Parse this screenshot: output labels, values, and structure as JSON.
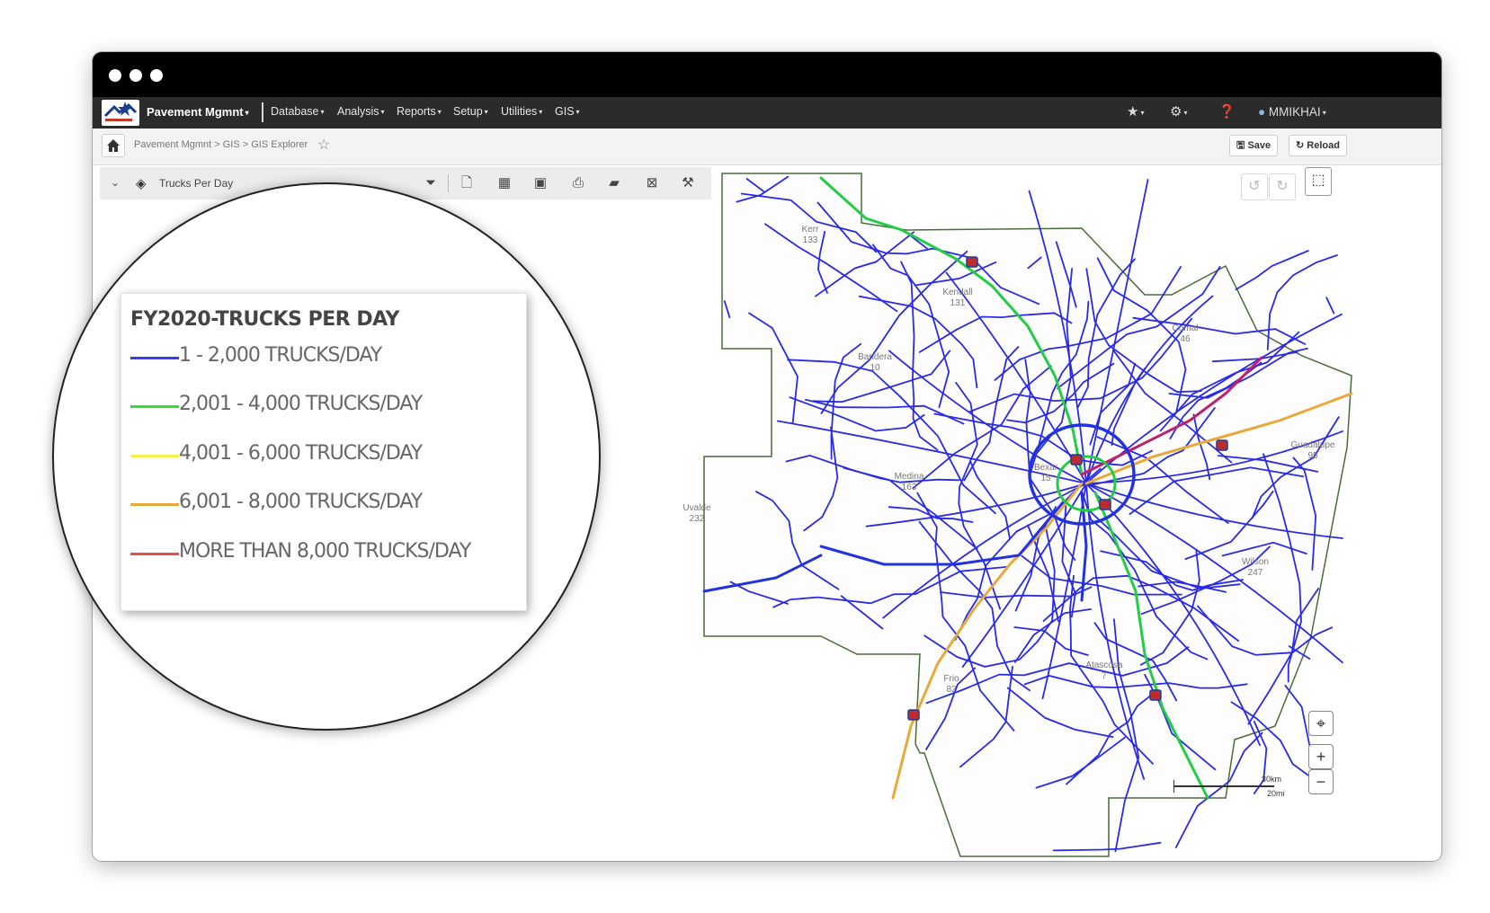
{
  "navbar": {
    "brand": "Pavement Mgmnt",
    "menus": [
      "Database",
      "Analysis",
      "Reports",
      "Setup",
      "Utilities",
      "GIS"
    ],
    "user": "MMIKHAI"
  },
  "breadcrumb": {
    "path": "Pavement Mgmnt > GIS > GIS Explorer"
  },
  "toolbar": {
    "save_label": "Save",
    "reload_label": "Reload"
  },
  "layer": {
    "name": "Trucks Per Day"
  },
  "legend": {
    "title": "FY2020-TRUCKS PER DAY",
    "items": [
      {
        "label": "1 - 2,000 TRUCKS/DAY",
        "color": "#3b3bf0"
      },
      {
        "label": "2,001 - 4,000 TRUCKS/DAY",
        "color": "#33dd33"
      },
      {
        "label": "4,001 - 6,000 TRUCKS/DAY",
        "color": "#f2f24a"
      },
      {
        "label": "6,001 - 8,000 TRUCKS/DAY",
        "color": "#e8a93a"
      },
      {
        "label": "MORE THAN 8,000 TRUCKS/DAY",
        "color": "#ee4a4a"
      }
    ]
  },
  "map": {
    "county_labels": [
      {
        "name": "Kerr",
        "code": "133"
      },
      {
        "name": "Kendall",
        "code": "131"
      },
      {
        "name": "Comal",
        "code": "46"
      },
      {
        "name": "Bandera",
        "code": "10"
      },
      {
        "name": "Medina",
        "code": "163"
      },
      {
        "name": "Bexar",
        "code": "15"
      },
      {
        "name": "Uvalde",
        "code": "232"
      },
      {
        "name": "Wilson",
        "code": "247"
      },
      {
        "name": "Frio",
        "code": "82"
      },
      {
        "name": "Atascosa",
        "code": "7"
      },
      {
        "name": "Guadalupe",
        "code": "95"
      }
    ],
    "scale": {
      "km": "30km",
      "mi": "20mi"
    },
    "road_color": "#2a2ae6",
    "boundary_color": "#4a6b3a"
  }
}
